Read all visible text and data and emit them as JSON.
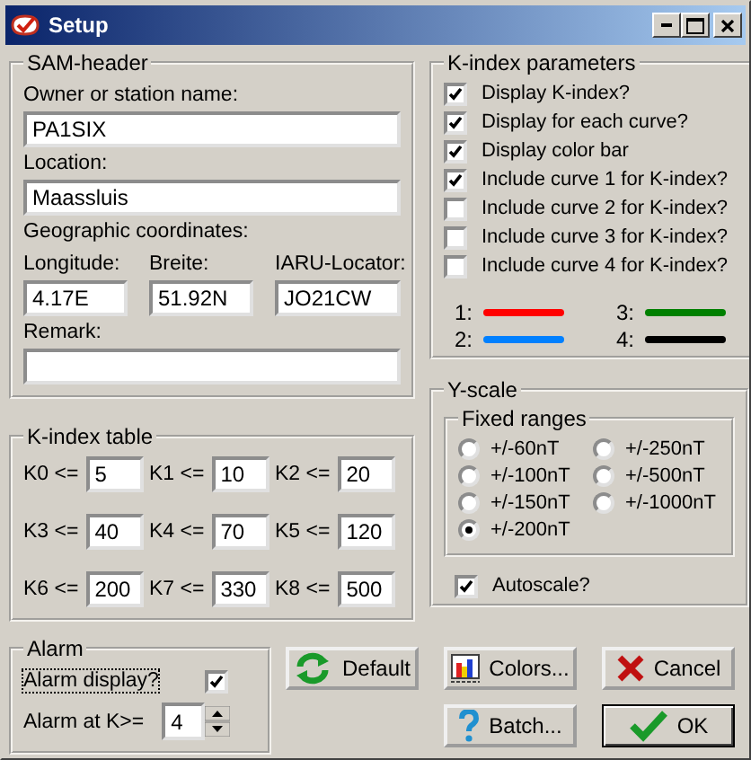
{
  "window": {
    "title": "Setup"
  },
  "sam_header": {
    "title": "SAM-header",
    "owner": {
      "label": "Owner or station name:",
      "value": "PA1SIX"
    },
    "location": {
      "label": "Location:",
      "value": "Maassluis"
    },
    "coordinates_label": "Geographic coordinates:",
    "coordinates": [
      {
        "label": "Longitude:",
        "value": "4.17E"
      },
      {
        "label": "Breite:",
        "value": "51.92N"
      },
      {
        "label": "IARU-Locator:",
        "value": "JO21CW"
      }
    ],
    "remark": {
      "label": "Remark:"
    }
  },
  "k_index_table": {
    "title": "K-index table",
    "entries": [
      {
        "label": "K0 <=",
        "value": "5"
      },
      {
        "label": "K1 <=",
        "value": "10"
      },
      {
        "label": "K2 <=",
        "value": "20"
      },
      {
        "label": "K3 <=",
        "value": "40"
      },
      {
        "label": "K4 <=",
        "value": "70"
      },
      {
        "label": "K5 <=",
        "value": "120"
      },
      {
        "label": "K6 <=",
        "value": "200"
      },
      {
        "label": "K7 <=",
        "value": "330"
      },
      {
        "label": "K8 <=",
        "value": "500"
      }
    ]
  },
  "k_index_parameters": {
    "title": "K-index parameters",
    "options": [
      {
        "label": "Display K-index?",
        "checked": true
      },
      {
        "label": "Display for each curve?",
        "checked": true
      },
      {
        "label": "Display color bar",
        "checked": true
      },
      {
        "label": "Include curve 1 for K-index?",
        "checked": true
      },
      {
        "label": "Include curve 2 for K-index?",
        "checked": false
      },
      {
        "label": "Include curve 3 for K-index?",
        "checked": false
      },
      {
        "label": "Include curve 4 for K-index?",
        "checked": false
      }
    ],
    "curve_colors": [
      {
        "label": "1:",
        "color": "#ff0000"
      },
      {
        "label": "2:",
        "color": "#0080ff"
      },
      {
        "label": "3:",
        "color": "#008000"
      },
      {
        "label": "4:",
        "color": "#000000"
      }
    ]
  },
  "y_scale": {
    "title": "Y-scale",
    "fixed_ranges": {
      "title": "Fixed  ranges",
      "options": [
        {
          "label": "+/-60nT",
          "selected": false
        },
        {
          "label": "+/-100nT",
          "selected": false
        },
        {
          "label": "+/-150nT",
          "selected": false
        },
        {
          "label": "+/-200nT",
          "selected": true
        },
        {
          "label": "+/-250nT",
          "selected": false
        },
        {
          "label": "+/-500nT",
          "selected": false
        },
        {
          "label": "+/-1000nT",
          "selected": false
        }
      ]
    },
    "autoscale": {
      "label": "Autoscale?",
      "checked": true
    }
  },
  "alarm": {
    "title": "Alarm",
    "display": {
      "label": "Alarm display?",
      "checked": true,
      "focused": true
    },
    "threshold": {
      "label": "Alarm at K>=",
      "value": "4"
    }
  },
  "buttons": [
    {
      "label": "Default",
      "kind": "default",
      "default": false
    },
    {
      "label": "Colors...",
      "kind": "colors",
      "default": false
    },
    {
      "label": "Cancel",
      "kind": "cancel",
      "default": false
    },
    {
      "label": "Batch...",
      "kind": "batch",
      "default": false
    },
    {
      "label": "OK",
      "kind": "ok",
      "default": true
    }
  ]
}
